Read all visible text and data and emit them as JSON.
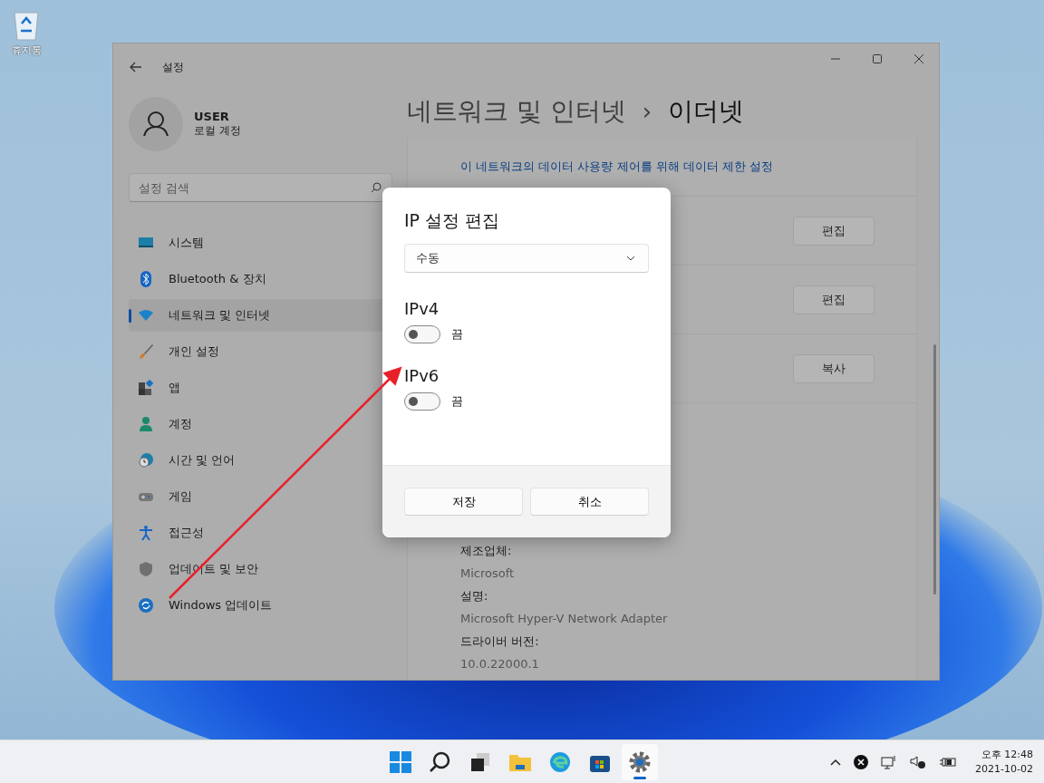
{
  "desktop": {
    "recycle_bin": "휴지통"
  },
  "window": {
    "title": "설정",
    "user": {
      "name": "USER",
      "account": "로컬 계정"
    },
    "search": {
      "placeholder": "설정 검색"
    },
    "nav": [
      {
        "kind": "system",
        "label": "시스템",
        "selected": false
      },
      {
        "kind": "bluetooth",
        "label": "Bluetooth & 장치",
        "selected": false
      },
      {
        "kind": "network",
        "label": "네트워크 및 인터넷",
        "selected": true
      },
      {
        "kind": "brush",
        "label": "개인 설정",
        "selected": false
      },
      {
        "kind": "apps",
        "label": "앱",
        "selected": false
      },
      {
        "kind": "person",
        "label": "계정",
        "selected": false
      },
      {
        "kind": "clock",
        "label": "시간 및 언어",
        "selected": false
      },
      {
        "kind": "gamepad",
        "label": "게임",
        "selected": false
      },
      {
        "kind": "access",
        "label": "접근성",
        "selected": false
      },
      {
        "kind": "shield",
        "label": "업데이트 및 보안",
        "selected": false
      },
      {
        "kind": "update",
        "label": "Windows 업데이트",
        "selected": false
      }
    ],
    "breadcrumb": {
      "parent": "네트워크 및 인터넷",
      "separator": "›",
      "current": "이더넷"
    },
    "link": "이 네트워크의 데이터 사용량 제어를 위해 데이터 제한 설정",
    "row_buttons": [
      "편집",
      "편집",
      "복사"
    ],
    "details": [
      {
        "label": "제조업체:",
        "value": "Microsoft"
      },
      {
        "label": "설명:",
        "value": "Microsoft Hyper-V Network Adapter"
      },
      {
        "label": "드라이버 버전:",
        "value": "10.0.22000.1"
      }
    ]
  },
  "dialog": {
    "title": "IP 설정 편집",
    "dropdown": {
      "value": "수동"
    },
    "sections": [
      {
        "label": "IPv4",
        "on": false,
        "state": "끔"
      },
      {
        "label": "IPv6",
        "on": false,
        "state": "끔"
      }
    ],
    "buttons": [
      "저장",
      "취소"
    ]
  },
  "taskbar": {
    "apps": [
      {
        "kind": "start",
        "selected": false
      },
      {
        "kind": "search",
        "selected": false
      },
      {
        "kind": "taskview",
        "selected": false
      },
      {
        "kind": "folder",
        "selected": false
      },
      {
        "kind": "edge",
        "selected": false
      },
      {
        "kind": "store",
        "selected": false
      },
      {
        "kind": "settings",
        "selected": true
      }
    ],
    "time": "오후 12:48",
    "date": "2021-10-02"
  }
}
